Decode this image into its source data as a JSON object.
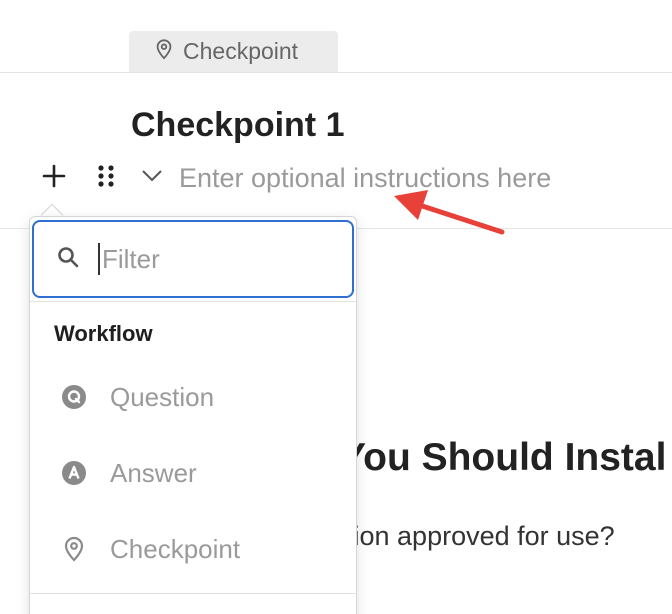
{
  "tag": {
    "label": "Checkpoint",
    "icon": "location-pin-icon"
  },
  "block": {
    "title": "Checkpoint 1",
    "instructions_placeholder": "Enter optional instructions here"
  },
  "controls": {
    "add_icon": "plus-icon",
    "drag_icon": "drag-handle-icon",
    "collapse_icon": "chevron-down-icon"
  },
  "background": {
    "heading_fragment": "You Should Instal",
    "text_fragment": "tion approved for use?"
  },
  "dropdown": {
    "filter_placeholder": "Filter",
    "section_label": "Workflow",
    "items": [
      {
        "label": "Question",
        "icon": "question-icon"
      },
      {
        "label": "Answer",
        "icon": "answer-icon"
      },
      {
        "label": "Checkpoint",
        "icon": "location-pin-icon"
      }
    ]
  },
  "colors": {
    "accent": "#2f6fd1",
    "annotation_arrow": "#e8413a",
    "muted_text": "#9a9a9a"
  }
}
